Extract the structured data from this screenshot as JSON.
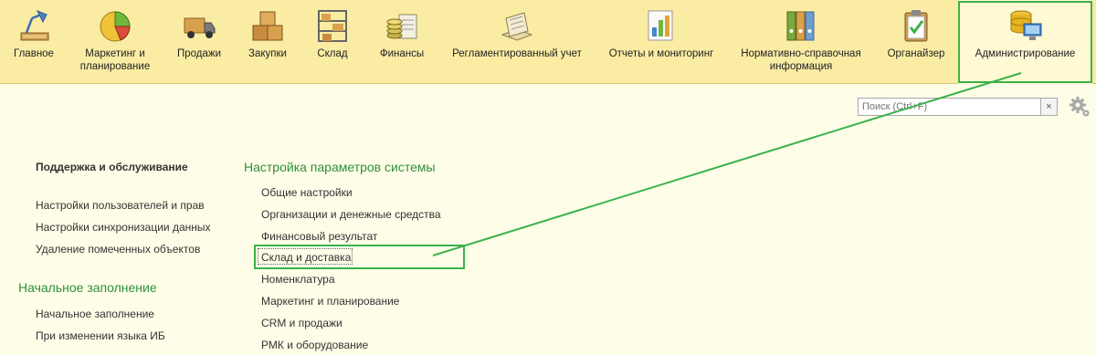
{
  "sections": [
    {
      "label": "Главное",
      "icon": "desk-lamp-icon"
    },
    {
      "label": "Маркетинг и\nпланирование",
      "icon": "pie-chart-icon"
    },
    {
      "label": "Продажи",
      "icon": "delivery-truck-icon"
    },
    {
      "label": "Закупки",
      "icon": "boxes-icon"
    },
    {
      "label": "Склад",
      "icon": "warehouse-shelf-icon"
    },
    {
      "label": "Финансы",
      "icon": "coins-icon"
    },
    {
      "label": "Регламентированный учет",
      "icon": "ledger-icon"
    },
    {
      "label": "Отчеты и мониторинг",
      "icon": "bar-chart-icon"
    },
    {
      "label": "Нормативно-справочная\nинформация",
      "icon": "binders-icon"
    },
    {
      "label": "Органайзер",
      "icon": "clipboard-icon"
    },
    {
      "label": "Администрирование",
      "icon": "database-computer-icon"
    }
  ],
  "search": {
    "placeholder": "Поиск (Ctrl+F)",
    "clear": "×"
  },
  "support": {
    "title": "Поддержка и обслуживание",
    "items": [
      "Настройки пользователей и прав",
      "Настройки синхронизации данных",
      "Удаление помеченных объектов"
    ]
  },
  "initial": {
    "title": "Начальное заполнение",
    "items": [
      "Начальное заполнение",
      "При изменении языка ИБ"
    ]
  },
  "settings": {
    "title": "Настройка параметров системы",
    "items": [
      "Общие настройки",
      "Организации и денежные средства",
      "Финансовый результат",
      "Склад и доставка",
      "Номенклатура",
      "Маркетинг и планирование",
      "CRM и продажи",
      "РМК и оборудование"
    ]
  },
  "colors": {
    "accent_green": "#3bb24a",
    "header_green": "#2f8f3e",
    "panel": "#fbeca4"
  }
}
